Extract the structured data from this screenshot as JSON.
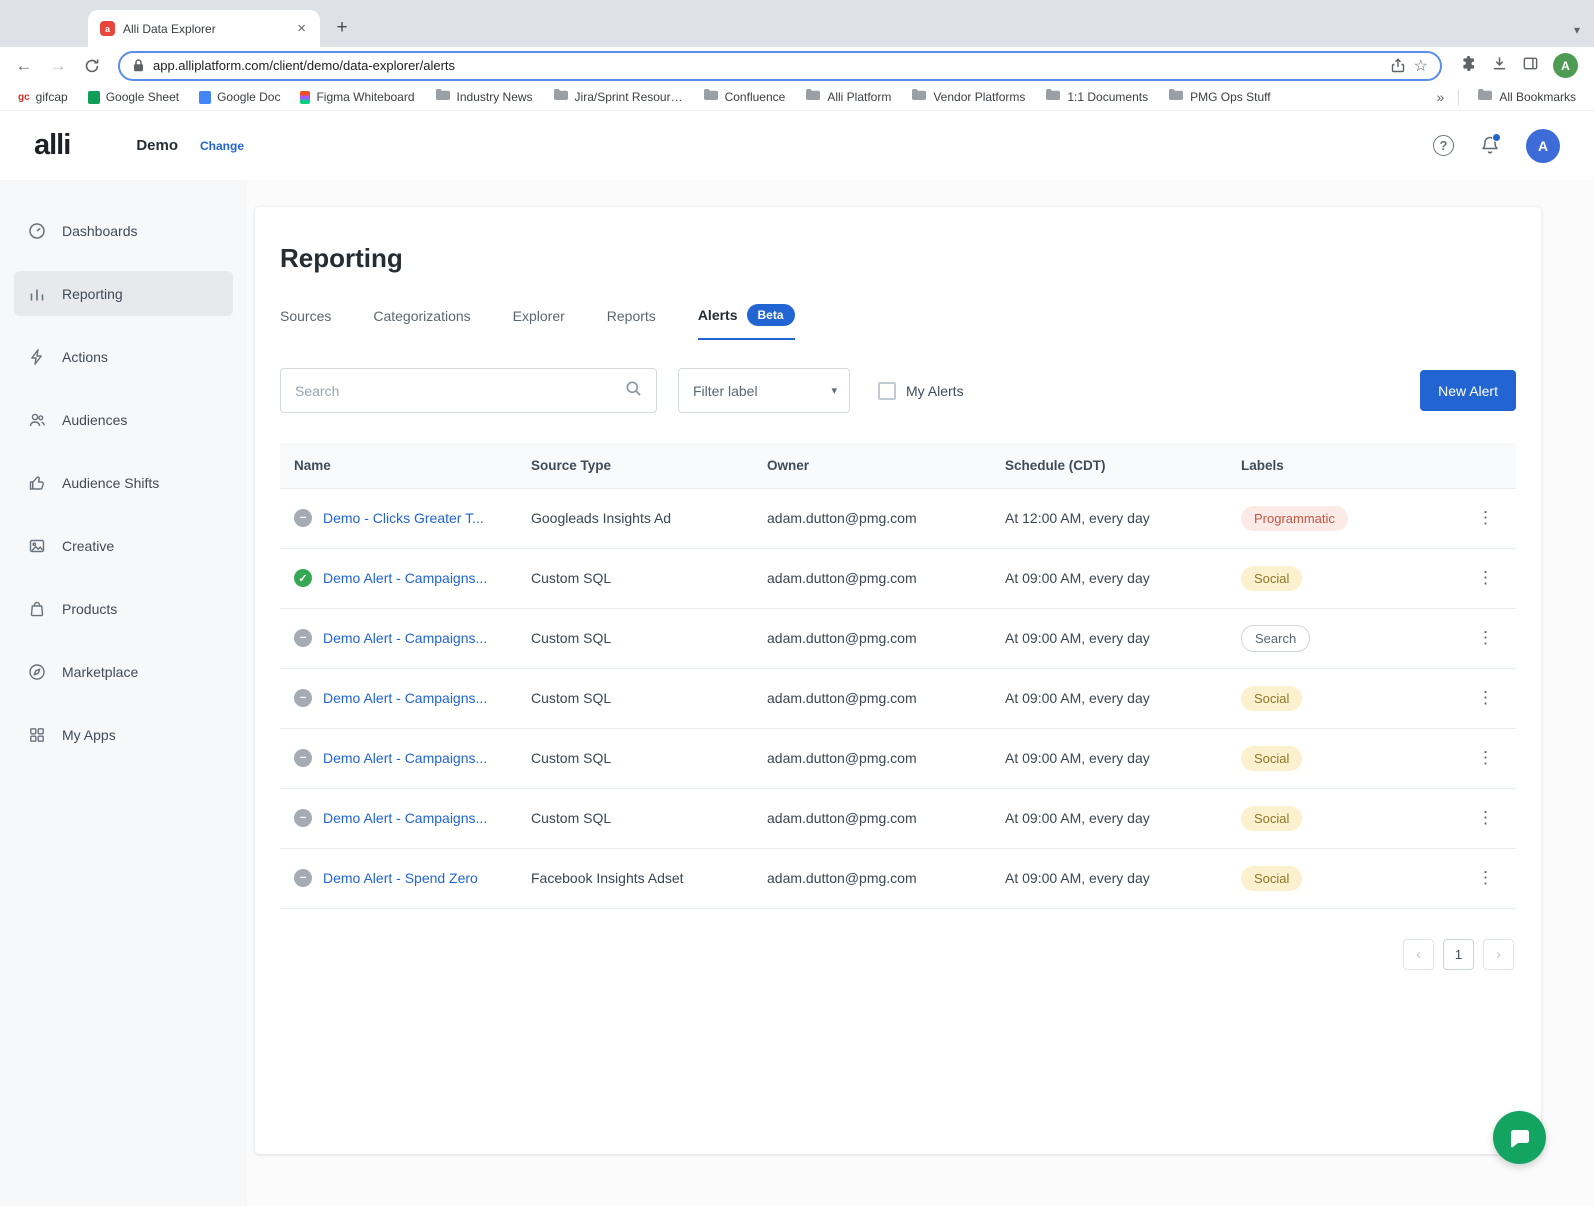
{
  "icons": {
    "close": "×",
    "plus": "+",
    "back": "←",
    "forward": "→",
    "star": "☆",
    "tabstrip_chevron": "▾",
    "dropdown_chevron": "▾",
    "kebab": "⋮",
    "check": "✓",
    "minus": "−",
    "chevron_left": "‹",
    "chevron_right": "›",
    "help": "?",
    "overflow": "»"
  },
  "browser": {
    "tab_title": "Alli Data Explorer",
    "favicon_letter": "a",
    "url": "app.alliplatform.com/client/demo/data-explorer/alerts",
    "avatar_letter": "A",
    "bookmarks": [
      {
        "label": "gifcap",
        "icon": "gc"
      },
      {
        "label": "Google Sheet",
        "icon": "sheet"
      },
      {
        "label": "Google Doc",
        "icon": "doc"
      },
      {
        "label": "Figma Whiteboard",
        "icon": "figma"
      },
      {
        "label": "Industry News",
        "icon": "folder"
      },
      {
        "label": "Jira/Sprint Resour…",
        "icon": "folder"
      },
      {
        "label": "Confluence",
        "icon": "folder"
      },
      {
        "label": "Alli Platform",
        "icon": "folder"
      },
      {
        "label": "Vendor Platforms",
        "icon": "folder"
      },
      {
        "label": "1:1 Documents",
        "icon": "folder"
      },
      {
        "label": "PMG Ops Stuff",
        "icon": "folder"
      }
    ],
    "all_bookmarks_label": "All Bookmarks"
  },
  "app_header": {
    "logo": "alli",
    "client_name": "Demo",
    "change_label": "Change",
    "avatar_letter": "A"
  },
  "sidebar": {
    "items": [
      {
        "label": "Dashboards",
        "icon": "dashboard",
        "active": false
      },
      {
        "label": "Reporting",
        "icon": "chart",
        "active": true
      },
      {
        "label": "Actions",
        "icon": "lightning",
        "active": false
      },
      {
        "label": "Audiences",
        "icon": "people",
        "active": false
      },
      {
        "label": "Audience Shifts",
        "icon": "thumb",
        "active": false
      },
      {
        "label": "Creative",
        "icon": "image",
        "active": false
      },
      {
        "label": "Products",
        "icon": "bag",
        "active": false
      },
      {
        "label": "Marketplace",
        "icon": "compass",
        "active": false
      },
      {
        "label": "My Apps",
        "icon": "apps",
        "active": false
      }
    ]
  },
  "main": {
    "page_title": "Reporting",
    "tabs": [
      {
        "label": "Sources",
        "active": false
      },
      {
        "label": "Categorizations",
        "active": false
      },
      {
        "label": "Explorer",
        "active": false
      },
      {
        "label": "Reports",
        "active": false
      },
      {
        "label": "Alerts",
        "active": true,
        "badge": "Beta"
      }
    ],
    "toolbar": {
      "search_placeholder": "Search",
      "filter_label_placeholder": "Filter label",
      "my_alerts_label": "My Alerts",
      "my_alerts_checked": false,
      "new_alert_label": "New Alert"
    },
    "table": {
      "columns": [
        "Name",
        "Source Type",
        "Owner",
        "Schedule (CDT)",
        "Labels"
      ],
      "rows": [
        {
          "status": "paused",
          "name": "Demo - Clicks Greater T...",
          "source_type": "Googleads Insights Ad",
          "owner": "adam.dutton@pmg.com",
          "schedule": "At 12:00 AM, every day",
          "label": "Programmatic",
          "label_style": "programmatic"
        },
        {
          "status": "active",
          "name": "Demo Alert - Campaigns...",
          "source_type": "Custom SQL",
          "owner": "adam.dutton@pmg.com",
          "schedule": "At 09:00 AM, every day",
          "label": "Social",
          "label_style": "social"
        },
        {
          "status": "paused",
          "name": "Demo Alert - Campaigns...",
          "source_type": "Custom SQL",
          "owner": "adam.dutton@pmg.com",
          "schedule": "At 09:00 AM, every day",
          "label": "Search",
          "label_style": "search"
        },
        {
          "status": "paused",
          "name": "Demo Alert - Campaigns...",
          "source_type": "Custom SQL",
          "owner": "adam.dutton@pmg.com",
          "schedule": "At 09:00 AM, every day",
          "label": "Social",
          "label_style": "social"
        },
        {
          "status": "paused",
          "name": "Demo Alert - Campaigns...",
          "source_type": "Custom SQL",
          "owner": "adam.dutton@pmg.com",
          "schedule": "At 09:00 AM, every day",
          "label": "Social",
          "label_style": "social"
        },
        {
          "status": "paused",
          "name": "Demo Alert - Campaigns...",
          "source_type": "Custom SQL",
          "owner": "adam.dutton@pmg.com",
          "schedule": "At 09:00 AM, every day",
          "label": "Social",
          "label_style": "social"
        },
        {
          "status": "paused",
          "name": "Demo Alert - Spend Zero",
          "source_type": "Facebook Insights Adset",
          "owner": "adam.dutton@pmg.com",
          "schedule": "At 09:00 AM, every day",
          "label": "Social",
          "label_style": "social"
        }
      ]
    },
    "pagination": {
      "current_page": "1"
    }
  }
}
